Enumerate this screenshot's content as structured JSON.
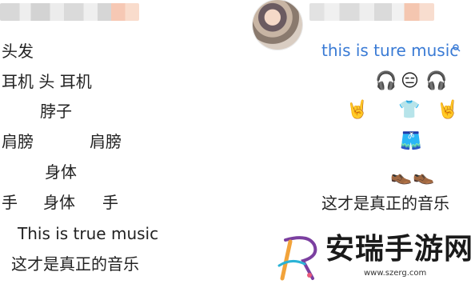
{
  "left_post": {
    "lines": [
      "头发",
      "耳机 头 耳机",
      "脖子",
      "肩膀",
      "肩膀",
      "身体",
      "手",
      "身体",
      "手",
      "This is true music",
      "这才是真正的音乐"
    ]
  },
  "right_post": {
    "title": "this is ture music",
    "emojis": {
      "row1": [
        "🎧",
        "😑",
        "🎧"
      ],
      "row2_left": "🤘",
      "row2_mid": "👕",
      "row2_right": "🤘",
      "row3": "🩳",
      "row4": [
        "👞",
        "👞"
      ]
    },
    "caption": "这才是真正的音乐"
  },
  "watermark": {
    "text": "安瑞手游网",
    "url": "www.szerg.com"
  },
  "colors": {
    "link_blue": "#3a7bd5",
    "text": "#222222",
    "logo_purple": "#7b3fa0",
    "logo_orange": "#f2a33a"
  }
}
